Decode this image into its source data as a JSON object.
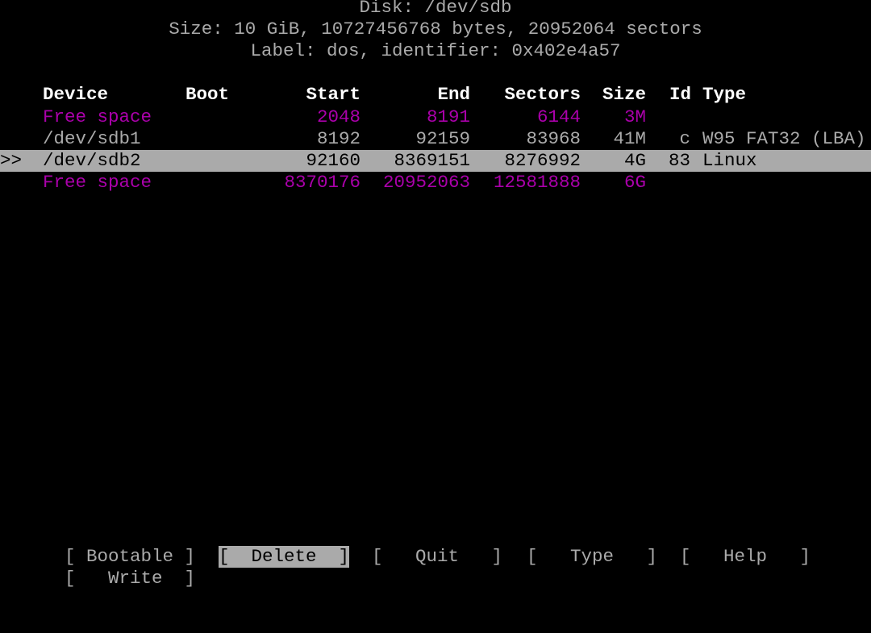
{
  "header": {
    "disk": "Disk: /dev/sdb",
    "size": "Size: 10 GiB, 10727456768 bytes, 20952064 sectors",
    "label": "Label: dos, identifier: 0x402e4a57"
  },
  "columns": {
    "device": "Device",
    "boot": "Boot",
    "start": "Start",
    "end": "End",
    "sectors": "Sectors",
    "size": "Size",
    "id": "Id",
    "type": "Type"
  },
  "rows": [
    {
      "marker": "",
      "device": "Free space",
      "boot": "",
      "start": "2048",
      "end": "8191",
      "sectors": "6144",
      "size": "3M",
      "id": "",
      "type": "",
      "kind": "free"
    },
    {
      "marker": "",
      "device": "/dev/sdb1",
      "boot": "",
      "start": "8192",
      "end": "92159",
      "sectors": "83968",
      "size": "41M",
      "id": "c",
      "type": "W95 FAT32 (LBA)",
      "kind": "part"
    },
    {
      "marker": ">>",
      "device": "/dev/sdb2",
      "boot": "",
      "start": "92160",
      "end": "8369151",
      "sectors": "8276992",
      "size": "4G",
      "id": "83",
      "type": "Linux",
      "kind": "selected"
    },
    {
      "marker": "",
      "device": "Free space",
      "boot": "",
      "start": "8370176",
      "end": "20952063",
      "sectors": "12581888",
      "size": "6G",
      "id": "",
      "type": "",
      "kind": "free"
    }
  ],
  "menu": {
    "bootable": "[ Bootable ]",
    "delete": "[  Delete  ]",
    "quit": "[   Quit   ]",
    "type": "[   Type   ]",
    "help": "[   Help   ]",
    "write": "[   Write  ]",
    "active": "delete"
  },
  "colors": {
    "free": "#aa00aa",
    "selected_bg": "#aaaaaa",
    "text": "#aaaaaa",
    "header": "#ffffff"
  }
}
